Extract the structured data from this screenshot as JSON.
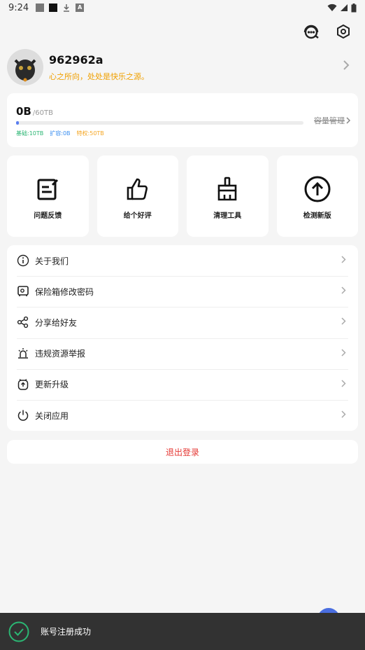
{
  "status_bar": {
    "time": "9:24"
  },
  "profile": {
    "username": "962962a",
    "motto": "心之所向，处处是快乐之源。"
  },
  "storage": {
    "used": "0B",
    "total": "/60TB",
    "used_fraction": 0.01,
    "manage_label": "容量管理",
    "legend": {
      "basic": "基础:10TB",
      "extended": "扩容:0B",
      "privilege": "特权:50TB"
    },
    "colors": {
      "bar": "#5a7ef0",
      "basic": "#2bb673",
      "extended": "#3a8ef0",
      "privilege": "#f5a623"
    }
  },
  "tiles": [
    {
      "label": "问题反馈",
      "icon": "feedback-icon"
    },
    {
      "label": "给个好评",
      "icon": "thumbs-up-icon"
    },
    {
      "label": "清理工具",
      "icon": "broom-icon"
    },
    {
      "label": "检测新版",
      "icon": "arrow-up-circle-icon"
    }
  ],
  "menu": [
    {
      "label": "关于我们",
      "icon": "info-icon"
    },
    {
      "label": "保险箱修改密码",
      "icon": "safe-icon"
    },
    {
      "label": "分享给好友",
      "icon": "share-icon"
    },
    {
      "label": "违规资源举报",
      "icon": "alarm-icon"
    },
    {
      "label": "更新升级",
      "icon": "clock-upgrade-icon"
    },
    {
      "label": "关闭应用",
      "icon": "power-icon"
    }
  ],
  "logout_label": "退出登录",
  "toast": {
    "message": "账号注册成功"
  },
  "accent_colors": {
    "motto": "#f0a000",
    "logout": "#e53935",
    "toast_bg": "#323232",
    "success": "#2bb673"
  }
}
